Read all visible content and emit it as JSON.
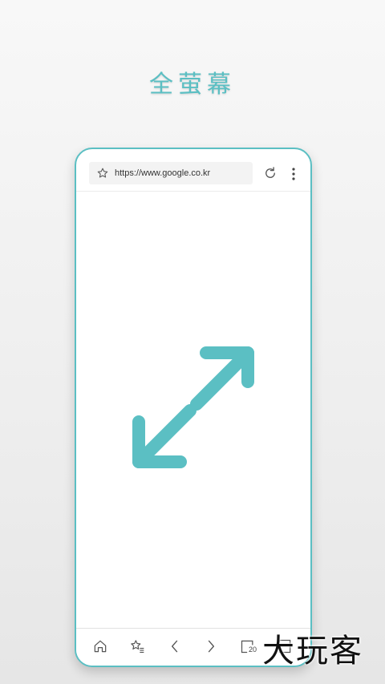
{
  "headline": "全萤幕",
  "browser": {
    "url": "https://www.google.co.kr",
    "tab_count": "20"
  },
  "icons": {
    "favorite": "star-outline-icon",
    "reload": "reload-icon",
    "menu": "kebab-menu-icon",
    "feature": "fullscreen-expand-icon",
    "nav": [
      "home-icon",
      "bookmarks-icon",
      "back-icon",
      "forward-icon",
      "tabs-icon",
      "page-icon"
    ]
  },
  "colors": {
    "accent": "#5bbfc3",
    "icon": "#555555"
  },
  "watermark": "大玩客"
}
